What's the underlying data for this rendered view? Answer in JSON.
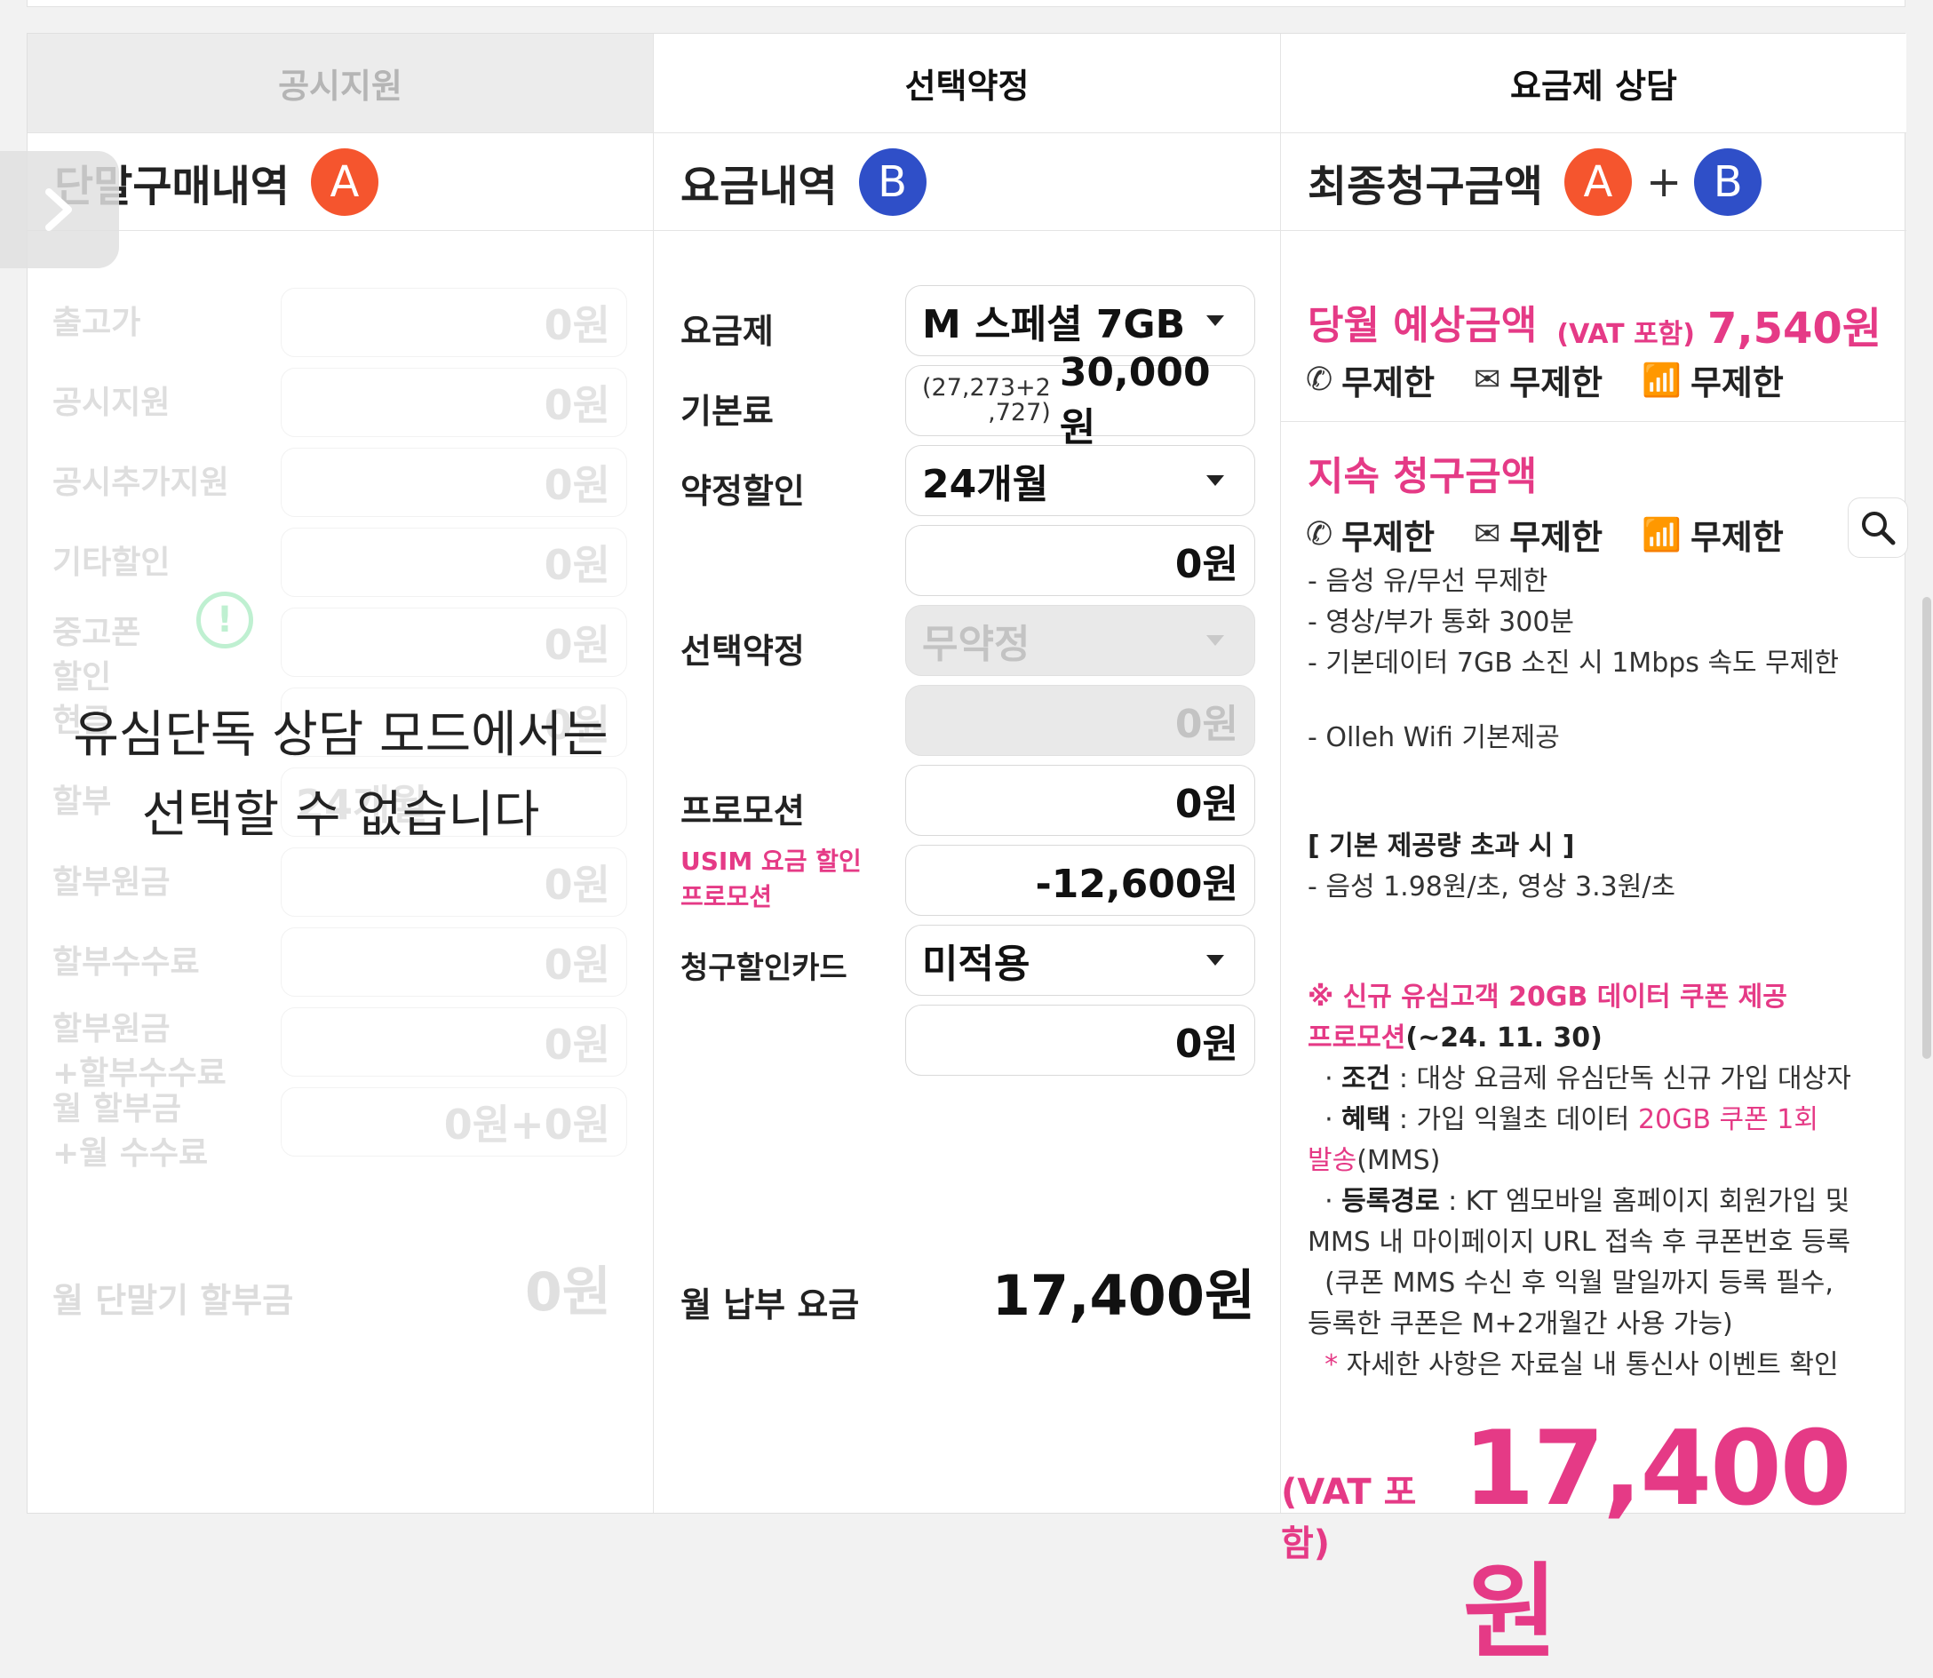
{
  "tabs": [
    "공시지원",
    "선택약정",
    "요금제 상담"
  ],
  "colA": {
    "title": "단말구매내역",
    "badge": "A",
    "rows": [
      {
        "label": "출고가",
        "value": "0원"
      },
      {
        "label": "공시지원",
        "value": "0원"
      },
      {
        "label": "공시추가지원",
        "value": "0원"
      },
      {
        "label": "기타할인",
        "value": "0원"
      },
      {
        "label": "중고폰\n할인",
        "value": "0원"
      },
      {
        "label": "현금",
        "value": "0원"
      },
      {
        "label": "할부",
        "value": "24개월"
      },
      {
        "label": "할부원금",
        "value": "0원"
      },
      {
        "label": "할부수수료",
        "value": "0원"
      },
      {
        "label": "할부원금\n+할부수수료",
        "value": "0원"
      },
      {
        "label": "월 할부금\n+월 수수료",
        "value": "0원+0원"
      }
    ],
    "warn_icon": "!",
    "overlay": "유심단독 상담 모드에서는\n선택할 수 없습니다",
    "monthly_label": "월 단말기 할부금",
    "monthly_value": "0원"
  },
  "colB": {
    "title": "요금내역",
    "badge": "B",
    "plan_label": "요금제",
    "plan_value": "M 스페셜 7GB",
    "base_label": "기본료",
    "base_sub1": "(27,273+2",
    "base_sub2": ",727)",
    "base_value": "30,000원",
    "contract_label": "약정할인",
    "contract_value": "24개월",
    "contract_amount": "0원",
    "select_label": "선택약정",
    "select_value": "무약정",
    "select_amount": "0원",
    "promo_label": "프로모션",
    "promo_value": "0원",
    "usim_label1": "USIM 요금 할인",
    "usim_label2": "프로모션",
    "usim_value": "-12,600원",
    "card_label": "청구할인카드",
    "card_value": "미적용",
    "card_amount": "0원",
    "monthly_label": "월 납부 요금",
    "monthly_value": "17,400원"
  },
  "colC": {
    "title": "최종청구금액",
    "badge_a": "A",
    "plus": "+",
    "badge_b": "B",
    "month_title": "당월 예상금액",
    "vat": "(VAT 포함)",
    "month_amount": "7,540원",
    "voice": "무제한",
    "sms": "무제한",
    "data": "무제한",
    "cont_title": "지속 청구금액",
    "details": [
      "- 음성 유/무선 무제한",
      "- 영상/부가 통화 300분",
      "- 기본데이터 7GB 소진 시 1Mbps 속도 무제한",
      "- Olleh Wifi 기본제공"
    ],
    "over_title": "[ 기본 제공량 초과 시 ]",
    "over_text": "- 음성 1.98원/초, 영상 3.3원/초",
    "promo_title": "※ 신규 유심고객 20GB 데이터 쿠폰 제공",
    "promo_title2": "프로모션",
    "promo_date": "(~24. 11. 30)",
    "cond_label": "조건",
    "cond_text": " : 대상 요금제 유심단독 신규 가입 대상자",
    "benefit_label": "혜택",
    "benefit_text": " : 가입 익월초 데이터 ",
    "benefit_pink": "20GB 쿠폰 1회",
    "benefit_pink2": "발송",
    "benefit_tail": "(MMS)",
    "route_label": "등록경로",
    "route_text": " : KT 엠모바일 홈페이지 회원가입 및",
    "route_text2": "MMS 내 마이페이지 URL 접속 후 쿠폰번호 등록",
    "route_text3": "  (쿠폰 MMS 수신 후 익월 말일까지 등록 필수,",
    "route_text4": "등록한 쿠폰은 M+2개월간 사용 가능)",
    "note_star": "*",
    "note": " 자세한 사항은 자료실 내 통신사 이벤트 확인",
    "final_vat": "(VAT 포함)",
    "final_amount": "17,400원"
  },
  "colors": {
    "pink": "#e53a86",
    "badge_a": "#f5552e",
    "badge_b": "#2f4fc8"
  }
}
